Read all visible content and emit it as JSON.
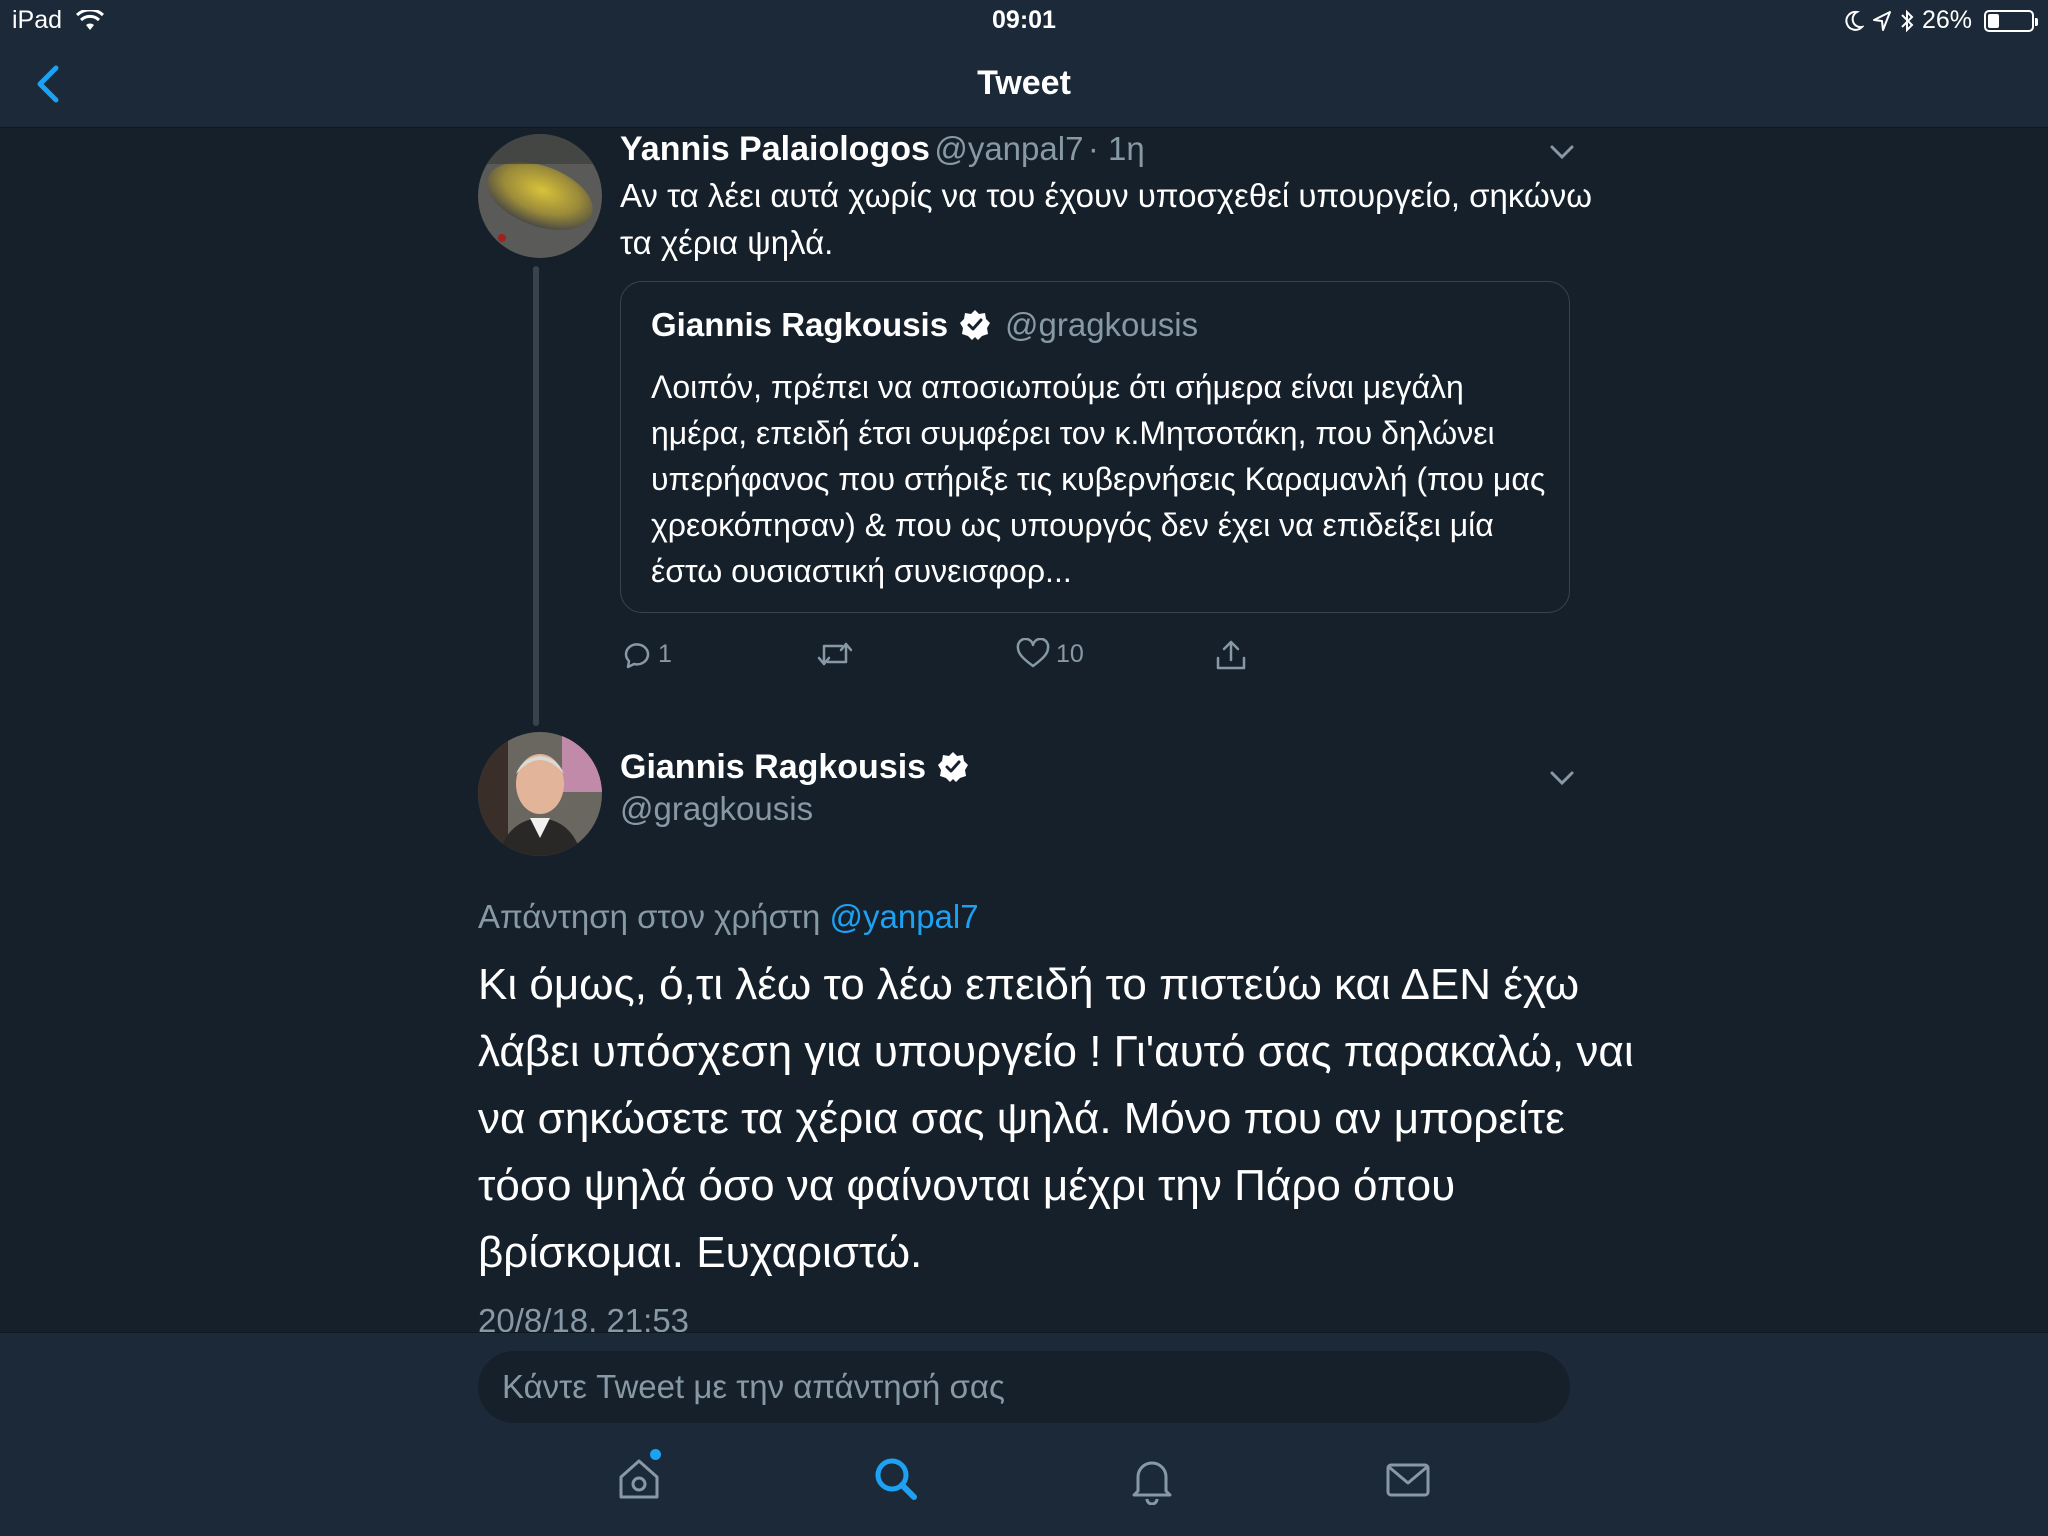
{
  "status_bar": {
    "device": "iPad",
    "time": "09:01",
    "battery_percent": "26%",
    "battery_level": 0.26
  },
  "nav": {
    "title": "Tweet",
    "back_icon": "chevron-left-icon"
  },
  "colors": {
    "background": "#15202b",
    "bar": "#1c2938",
    "accent": "#1da1f2",
    "secondary_text": "#8899a6",
    "border": "#38444d"
  },
  "tweet1": {
    "name": "Yannis Palaiologos",
    "handle": "@yanpal7",
    "time": "· 1η",
    "text": "Αν τα λέει αυτά χωρίς να του έχουν υποσχεθεί υπουργείο, σηκώνω τα χέρια ψηλά.",
    "quote": {
      "name": "Giannis Ragkousis",
      "handle": "@gragkousis",
      "text": "Λοιπόν, πρέπει να αποσιωπούμε ότι σήμερα είναι μεγάλη ημέρα, επειδή έτσι συμφέρει τον κ.Μητσοτάκη, που δηλώνει υπερήφανος που στήριξε τις κυβερνήσεις Καραμανλή (που μας χρεοκόπησαν) & που ως υπουργός δεν έχει να επιδείξει μία έστω ουσιαστική συνεισφορ..."
    },
    "actions": {
      "reply_count": "1",
      "retweet_count": "",
      "like_count": "10"
    }
  },
  "tweet2": {
    "name": "Giannis Ragkousis",
    "handle": "@gragkousis",
    "reply_prefix": "Απάντηση στον χρήστη",
    "reply_handle": "@yanpal7",
    "text": "Κι όμως, ό,τι λέω το λέω επειδή το πιστεύω και ΔΕΝ έχω λάβει υπόσχεση για υπουργείο ! Γι'αυτό σας παρακαλώ, ναι να σηκώσετε τα χέρια σας ψηλά. Μόνο που αν μπορείτε τόσο ψηλά όσο να φαίνονται μέχρι την Πάρο όπου βρίσκομαι. Ευχαριστώ.",
    "timestamp": "20/8/18, 21:53"
  },
  "compose": {
    "placeholder": "Κάντε Tweet με την απάντησή σας"
  },
  "tabs": [
    "home-icon",
    "search-icon",
    "bell-icon",
    "mail-icon"
  ]
}
